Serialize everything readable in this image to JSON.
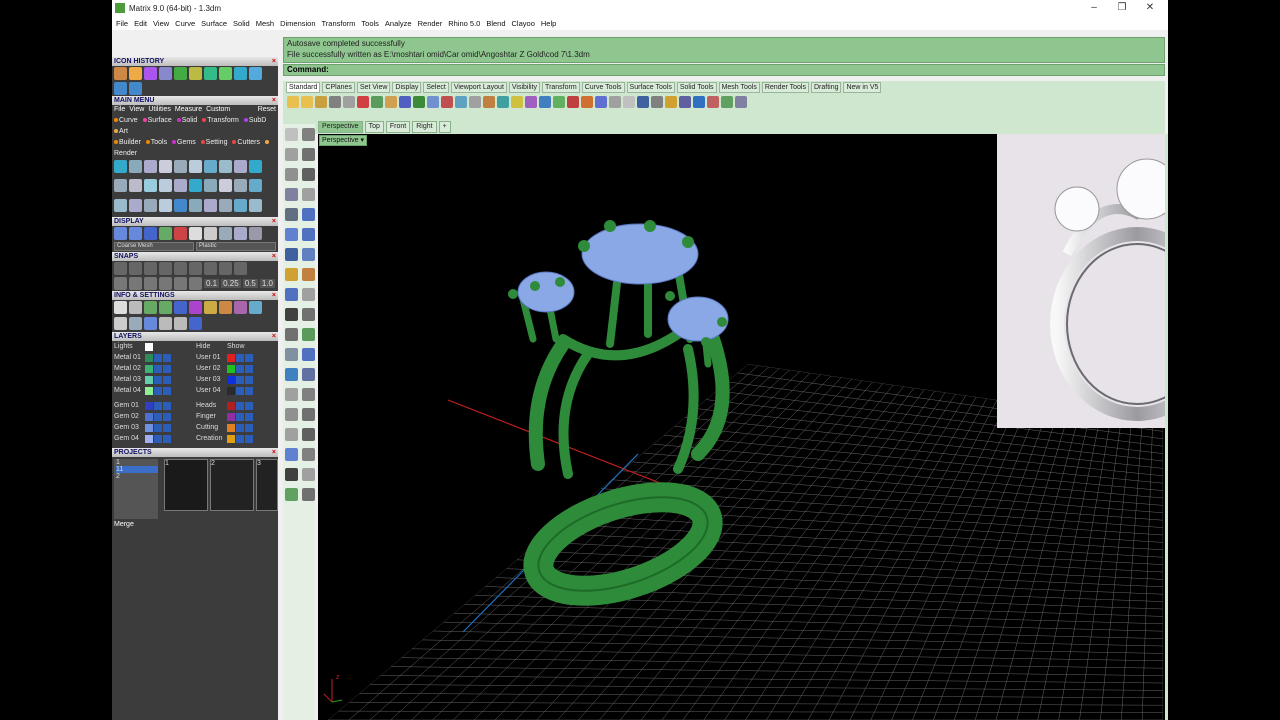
{
  "window": {
    "title": "Matrix 9.0 (64-bit) - 1.3dm",
    "controls": [
      "–",
      "❐",
      "✕"
    ]
  },
  "menubar": [
    "File",
    "Edit",
    "View",
    "Curve",
    "Surface",
    "Solid",
    "Mesh",
    "Dimension",
    "Transform",
    "Tools",
    "Analyze",
    "Render",
    "Rhino 5.0",
    "Blend",
    "Clayoo",
    "Help"
  ],
  "left_panel": {
    "icon_history": "ICON HISTORY",
    "main_menu": {
      "title": "MAIN MENU",
      "menu": [
        "File",
        "View",
        "Utilities",
        "Measure",
        "Custom"
      ],
      "reset": "Reset",
      "tabs_row1": [
        "Curve",
        "Surface",
        "Solid",
        "Transform",
        "SubD",
        "Art"
      ],
      "tabs_row2": [
        "Builder",
        "Tools",
        "Gems",
        "Setting",
        "Cutters",
        "Render"
      ]
    },
    "display": {
      "title": "DISPLAY",
      "mesh_select": "Coarse Mesh",
      "material_select": "Plastic"
    },
    "snaps": {
      "title": "SNAPS",
      "values": [
        "0.1",
        "0.25",
        "0.5",
        "1.0"
      ]
    },
    "info": "INFO & SETTINGS",
    "layers": {
      "title": "LAYERS",
      "lights": "Lights",
      "hide": "Hide",
      "show": "Show",
      "rows": [
        {
          "left": "Metal 01",
          "left_color": "#2e8b57",
          "right": "User 01",
          "right_color": "#e02020"
        },
        {
          "left": "Metal 02",
          "left_color": "#3cb371",
          "right": "User 02",
          "right_color": "#20c020"
        },
        {
          "left": "Metal 03",
          "left_color": "#66cdaa",
          "right": "User 03",
          "right_color": "#1030e0"
        },
        {
          "left": "Metal 04",
          "left_color": "#90ee90",
          "right": "User 04",
          "right_color": "#2a2a2a"
        },
        {
          "left": "Gem 01",
          "left_color": "#3040c0",
          "right": "Heads",
          "right_color": "#b02020"
        },
        {
          "left": "Gem 02",
          "left_color": "#5070d0",
          "right": "Finger",
          "right_color": "#9030a0"
        },
        {
          "left": "Gem 03",
          "left_color": "#7090e0",
          "right": "Cutting",
          "right_color": "#e08020"
        },
        {
          "left": "Gem 04",
          "left_color": "#a0b0f0",
          "right": "Creation",
          "right_color": "#e0a010"
        }
      ]
    },
    "projects": {
      "title": "PROJECTS",
      "list": [
        "1",
        "11",
        "2"
      ],
      "slots": [
        "1",
        "2",
        "3"
      ],
      "merge": "Merge"
    }
  },
  "status": {
    "line1": "Autosave completed successfully",
    "line2": "File successfully written as E:\\moshtari  omid\\Car omid\\Angoshtar  Z  Gold\\cod 7\\1.3dm",
    "command": "Command:"
  },
  "toolbar_tabs": [
    "Standard",
    "CPlanes",
    "Set View",
    "Display",
    "Select",
    "Viewport Layout",
    "Visibility",
    "Transform",
    "Curve Tools",
    "Surface Tools",
    "Solid Tools",
    "Mesh Tools",
    "Render Tools",
    "Drafting",
    "New in V5"
  ],
  "viewport_tabs": [
    "Perspective",
    "Top",
    "Front",
    "Right",
    "+"
  ],
  "viewport": {
    "label": "Perspective",
    "axis_z": "z",
    "axis_x": "x",
    "axis_y": "y"
  },
  "colors": {
    "status_green": "#8fc68f",
    "ring_green": "#2e8b3a",
    "gem_blue": "#8aa7e6"
  }
}
